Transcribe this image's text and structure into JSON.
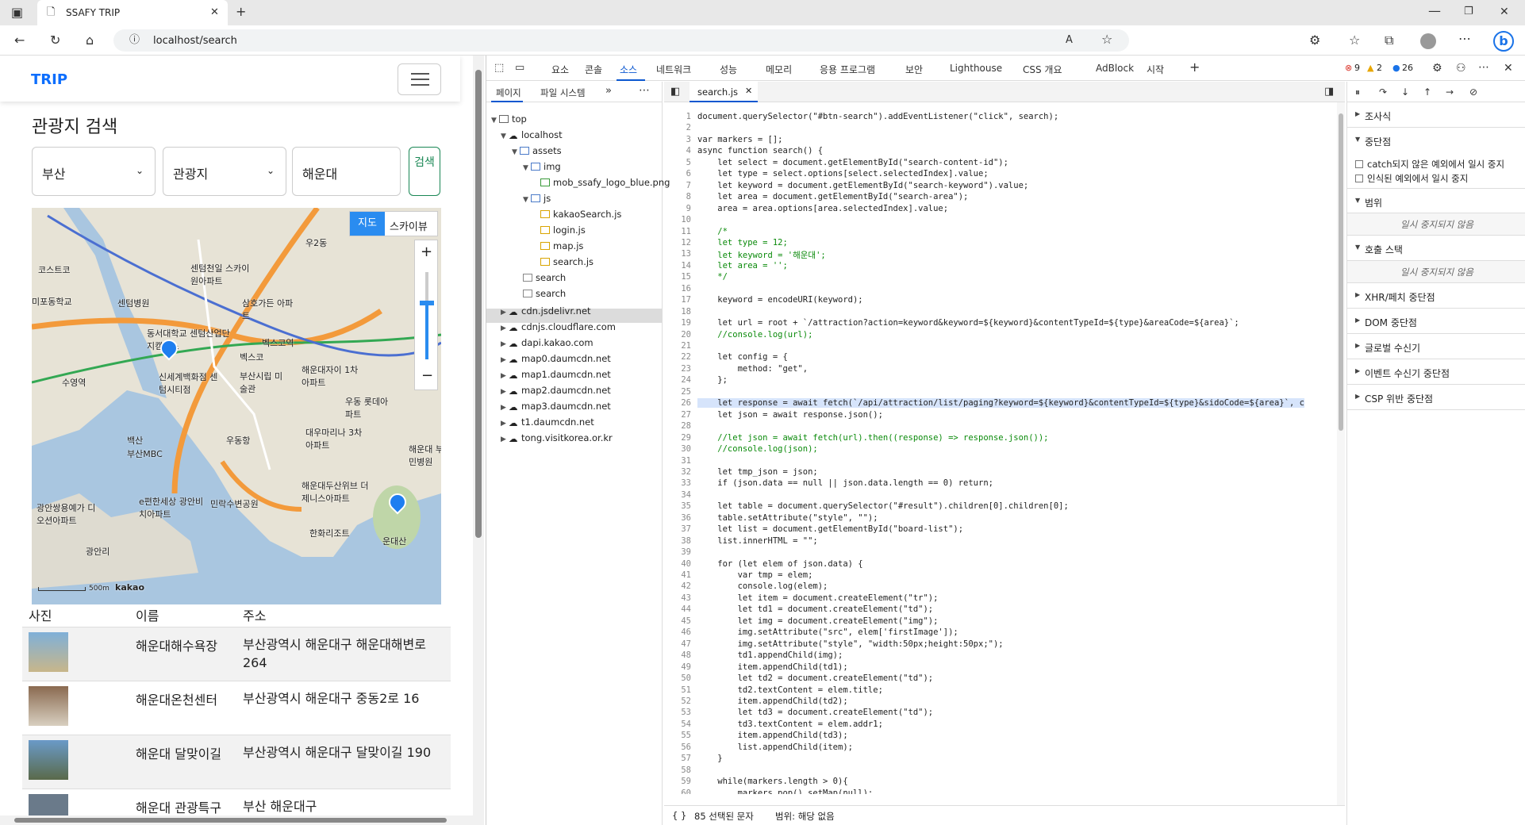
{
  "browser": {
    "tab_title": "SSAFY TRIP",
    "url": "localhost/search"
  },
  "page": {
    "brand": "TRIP",
    "title": "관광지 검색",
    "select_area": "부산",
    "select_type": "관광지",
    "keyword": "해운대",
    "search_button": "검색",
    "map": {
      "type_map": "지도",
      "type_sky": "스카이뷰",
      "scale": "500m",
      "logo": "kakao",
      "labels": [
        "센텀천일 스카이원아파트",
        "코스트코",
        "센텀병원",
        "동서대학교 센텀산업단지캠퍼스",
        "삼호가든 아파트",
        "신세계백화점 센텀시티점",
        "벡스코역",
        "벡스코",
        "수영역",
        "부산시립 미술관",
        "해운대자이 1차아파트",
        "우동 롯데아파트",
        "백산",
        "부산MBC",
        "대우마리나 3차아파트",
        "해운대 부민병원",
        "해운대두산위브 더제니스아파트",
        "광안쌍용예가 디오션아파트",
        "e편한세상 광안비치아파트",
        "민락수변공원",
        "한화리조트",
        "운대산",
        "광안리",
        "우2동",
        "우동항",
        "미포동학교"
      ]
    },
    "table": {
      "headers": [
        "사진",
        "이름",
        "주소"
      ],
      "rows": [
        {
          "name": "해운대해수욕장",
          "addr": "부산광역시 해운대구 해운대해변로 264"
        },
        {
          "name": "해운대온천센터",
          "addr": "부산광역시 해운대구 중동2로 16"
        },
        {
          "name": "해운대 달맞이길",
          "addr": "부산광역시 해운대구 달맞이길 190"
        },
        {
          "name": "해운대 관광특구",
          "addr": "부산 해운대구"
        }
      ]
    }
  },
  "devtools": {
    "tabs": [
      "요소",
      "콘솔",
      "소스",
      "네트워크",
      "성능",
      "메모리",
      "응용 프로그램",
      "보안",
      "Lighthouse",
      "CSS 개요",
      "AdBlock",
      "시작"
    ],
    "errors": "9",
    "warnings": "2",
    "messages": "26",
    "nav_tabs": [
      "페이지",
      "파일 시스템"
    ],
    "tree": [
      "top",
      "localhost",
      "assets",
      "img",
      "mob_ssafy_logo_blue.png",
      "js",
      "kakaoSearch.js",
      "login.js",
      "map.js",
      "search.js",
      "search",
      "search",
      "cdn.jsdelivr.net",
      "cdnjs.cloudflare.com",
      "dapi.kakao.com",
      "map0.daumcdn.net",
      "map1.daumcdn.net",
      "map2.daumcdn.net",
      "map3.daumcdn.net",
      "t1.daumcdn.net",
      "tong.visitkorea.or.kr"
    ],
    "editor_tab": "search.js",
    "status_left": "{ }",
    "status_sel": "85 선택된 문자",
    "status_scope": "범위: 해당 없음",
    "side_sections": [
      "조사식",
      "중단점",
      "범위",
      "호출 스택",
      "XHR/페치 중단점",
      "DOM 중단점",
      "글로벌 수신기",
      "이벤트 수신기 중단점",
      "CSP 위반 중단점"
    ],
    "bp_check1": "catch되지 않은 예외에서 일시 중지",
    "bp_check2": "인식된 예외에서 일시 중지",
    "not_paused": "일시 중지되지 않음",
    "code": [
      "document.querySelector(\"#btn-search\").addEventListener(\"click\", search);",
      "",
      "var markers = [];",
      "async function search() {",
      "    let select = document.getElementById(\"search-content-id\");",
      "    let type = select.options[select.selectedIndex].value;",
      "    let keyword = document.getElementById(\"search-keyword\").value;",
      "    let area = document.getElementById(\"search-area\");",
      "    area = area.options[area.selectedIndex].value;",
      "",
      "    /*",
      "    let type = 12;",
      "    let keyword = '해운대';",
      "    let area = '';",
      "    */",
      "",
      "    keyword = encodeURI(keyword);",
      "",
      "    let url = root + `/attraction?action=keyword&keyword=${keyword}&contentTypeId=${type}&areaCode=${area}`;",
      "    //console.log(url);",
      "",
      "    let config = {",
      "        method: \"get\",",
      "    };",
      "",
      "    let response = await fetch(`/api/attraction/list/paging?keyword=${keyword}&contentTypeId=${type}&sidoCode=${area}`, c",
      "    let json = await response.json();",
      "",
      "    //let json = await fetch(url).then((response) => response.json());",
      "    //console.log(json);",
      "",
      "    let tmp_json = json;",
      "    if (json.data == null || json.data.length == 0) return;",
      "",
      "    let table = document.querySelector(\"#result\").children[0].children[0];",
      "    table.setAttribute(\"style\", \"\");",
      "    let list = document.getElementById(\"board-list\");",
      "    list.innerHTML = \"\";",
      "",
      "    for (let elem of json.data) {",
      "        var tmp = elem;",
      "        console.log(elem);",
      "        let item = document.createElement(\"tr\");",
      "        let td1 = document.createElement(\"td\");",
      "        let img = document.createElement(\"img\");",
      "        img.setAttribute(\"src\", elem['firstImage']);",
      "        img.setAttribute(\"style\", \"width:50px;height:50px;\");",
      "        td1.appendChild(img);",
      "        item.appendChild(td1);",
      "        let td2 = document.createElement(\"td\");",
      "        td2.textContent = elem.title;",
      "        item.appendChild(td2);",
      "        let td3 = document.createElement(\"td\");",
      "        td3.textContent = elem.addr1;",
      "        item.appendChild(td3);",
      "        list.appendChild(item);",
      "    }",
      "",
      "    while(markers.length > 0){",
      "        markers.pop().setMap(null);"
    ]
  }
}
